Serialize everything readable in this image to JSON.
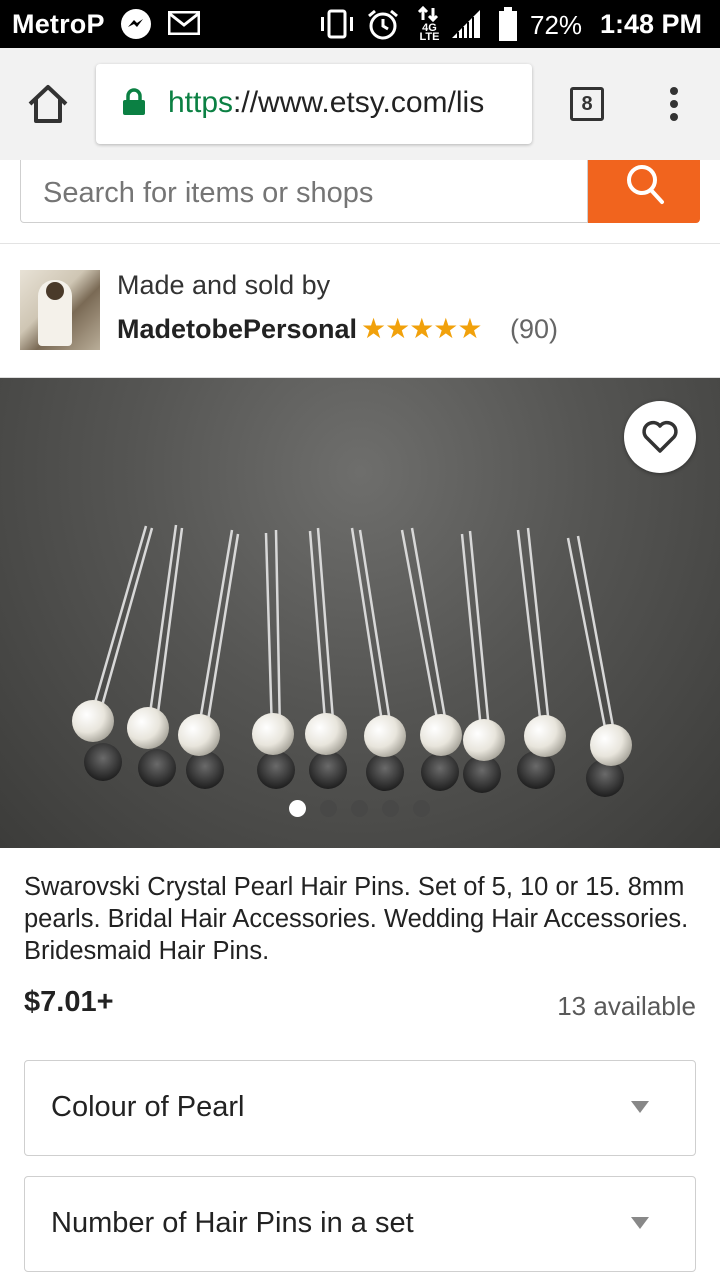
{
  "status_bar": {
    "carrier": "MetroP",
    "network": "4G LTE",
    "battery_percent": "72%",
    "time": "1:48 PM",
    "icons": [
      "messenger-icon",
      "mail-icon",
      "vibrate-icon",
      "alarm-icon",
      "data-arrows-icon",
      "signal-icon",
      "battery-icon"
    ]
  },
  "browser": {
    "url_scheme": "https",
    "url_rest": "://www.etsy.com/lis",
    "tab_count": "8",
    "icons": [
      "home-icon",
      "lock-icon",
      "more-vert-icon"
    ],
    "accent_color": "#0b8043"
  },
  "search": {
    "placeholder": "Search for items or shops",
    "button_color": "#f1641e"
  },
  "seller": {
    "made_by_label": "Made and sold by",
    "shop_name": "MadetobePersonal",
    "rating": 5,
    "stars_text": "★★★★★",
    "review_count": "(90)"
  },
  "gallery": {
    "image_count": 5,
    "active_index": 0,
    "favorite_icon": "heart-outline-icon"
  },
  "listing": {
    "title": "Swarovski Crystal Pearl Hair Pins. Set of 5, 10 or 15. 8mm pearls. Bridal Hair Accessories. Wedding Hair Accessories. Bridesmaid Hair Pins.",
    "price": "$7.01+",
    "availability": "13 available"
  },
  "options": [
    {
      "label": "Colour of Pearl"
    },
    {
      "label": "Number of Hair Pins in a set"
    }
  ]
}
